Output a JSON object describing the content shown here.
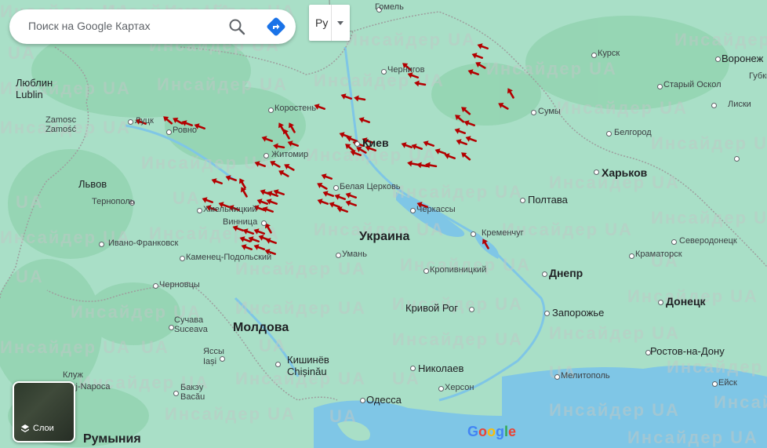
{
  "search": {
    "placeholder": "Поиск на Google Картах"
  },
  "language": {
    "selected": "Ру"
  },
  "layers": {
    "label": "Слои"
  },
  "watermark": "Инсайдер UA",
  "countries": {
    "ukraine": "Украина",
    "moldova": "Молдова",
    "romania": "Румыния"
  },
  "cities": {
    "gomel": "Гомель",
    "chernigov": "Чернигов",
    "kursk": "Курск",
    "voronezh": "Воронеж",
    "stary_oskol": "Старый Оскол",
    "lublin": "Люблин\nLublin",
    "zamosc": "Zamosc\nZamość",
    "lutsk": "Луцк",
    "rovno": "Ровно",
    "korosten": "Коростень",
    "kiev": "Киев",
    "sumy": "Сумы",
    "belgorod": "Белгород",
    "gubkin": "Губкин",
    "liski": "Лиски",
    "zhitomir": "Житомир",
    "lvov": "Львов",
    "ternopol": "Тернополь",
    "belaya_tserkov": "Белая Церковь",
    "kharkov": "Харьков",
    "khmelnitsky": "Хмельницкий",
    "cherkassy": "Черкассы",
    "poltava": "Полтава",
    "vinnitsa": "Винница",
    "kremenchug": "Кременчуг",
    "ivano_frankovsk": "Ивано-Франковск",
    "kamenets": "Каменец-Подольский",
    "uman": "Умань",
    "severodonetsk": "Северодонецк",
    "kramatorsk": "Краматорск",
    "kropivnitsky": "Кропивницкий",
    "dnepr": "Днепр",
    "chernovtsy": "Черновцы",
    "donetsk": "Донецк",
    "krivoy_rog": "Кривой Рог",
    "zaporozhye": "Запорожье",
    "suceava": "Сучава\nSuceava",
    "rostov": "Ростов-на-Дону",
    "iasi": "Яссы\nIași",
    "kishinev": "Кишинёв\nChișinău",
    "nikolaev": "Николаев",
    "eysk": "Ейск",
    "kherson": "Херсон",
    "melitopol": "Мелитополь",
    "cluj": "Клуж\nCluj-Napoca",
    "bacau": "Бакэу\nBacău",
    "odessa": "Одесса"
  },
  "colors": {
    "land": "#a9dfc7",
    "water": "#7fc6e6",
    "drone": "#b30000"
  }
}
